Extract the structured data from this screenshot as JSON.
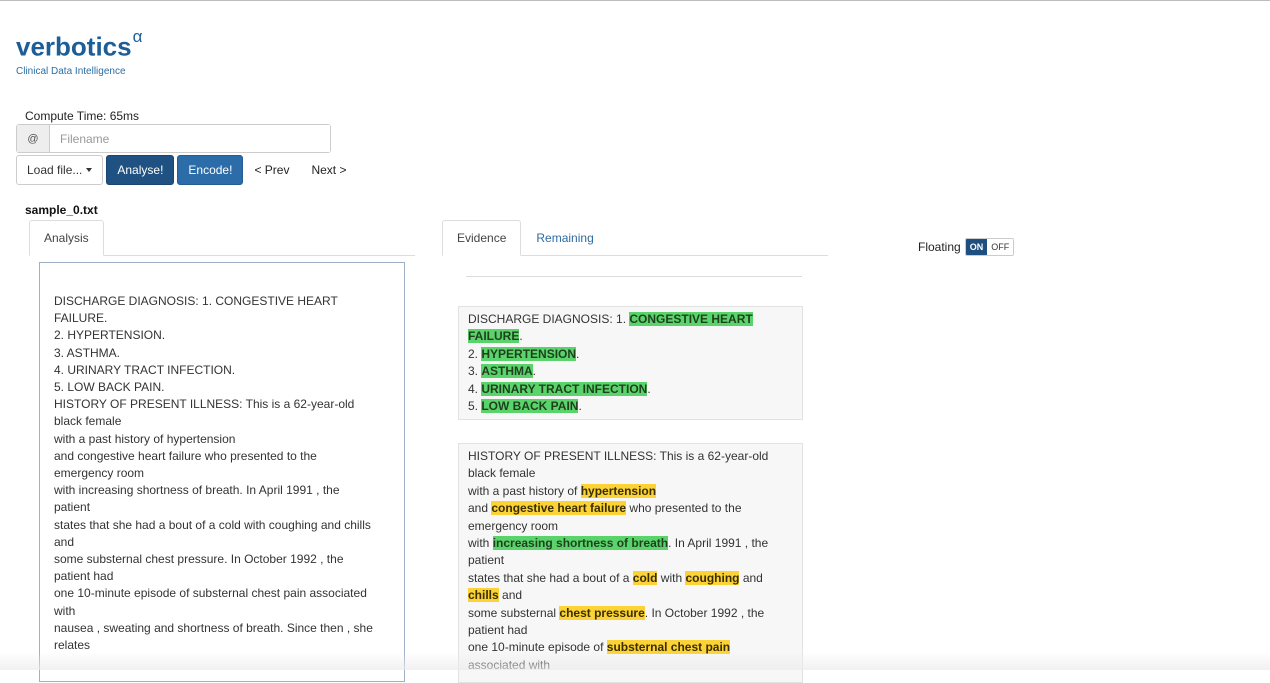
{
  "brand": {
    "name": "verbotics",
    "superscript": "α",
    "tagline": "Clinical Data Intelligence"
  },
  "compute_time": "Compute Time: 65ms",
  "filename_input": {
    "addon": "@",
    "placeholder": "Filename",
    "value": ""
  },
  "toolbar": {
    "load_label": "Load file...",
    "analyse_label": "Analyse!",
    "encode_label": "Encode!",
    "prev_label": "< Prev",
    "next_label": "Next >"
  },
  "current_file": "sample_0.txt",
  "analysis_tabs": [
    "Analysis"
  ],
  "evidence_tabs": [
    "Evidence",
    "Remaining"
  ],
  "floating": {
    "label": "Floating",
    "on": "ON",
    "off": "OFF",
    "state": "ON"
  },
  "analysis_lines": [
    "DISCHARGE DIAGNOSIS: 1. CONGESTIVE HEART",
    "FAILURE.",
    "2. HYPERTENSION.",
    "3. ASTHMA.",
    "4. URINARY TRACT INFECTION.",
    "5. LOW BACK PAIN.",
    "HISTORY OF PRESENT ILLNESS: This is a 62-year-old",
    "black female",
    "with a past history of hypertension",
    "and congestive heart failure who presented to the",
    "emergency room",
    "with increasing shortness of breath. In April 1991 , the",
    "patient",
    "states that she had a bout of a cold with coughing and chills",
    "and",
    "some substernal chest pressure. In October 1992 , the",
    "patient had",
    "one 10-minute episode of substernal chest pain associated",
    "with",
    "nausea , sweating and shortness of breath. Since then , she",
    "relates"
  ],
  "evidence_blocks": [
    [
      [
        {
          "t": "DISCHARGE DIAGNOSIS: 1. "
        },
        {
          "t": "CONGESTIVE HEART",
          "h": "g"
        }
      ],
      [
        {
          "t": "FAILURE",
          "h": "g"
        },
        {
          "t": "."
        }
      ],
      [
        {
          "t": "2. "
        },
        {
          "t": "HYPERTENSION",
          "h": "g"
        },
        {
          "t": "."
        }
      ],
      [
        {
          "t": "3. "
        },
        {
          "t": "ASTHMA",
          "h": "g"
        },
        {
          "t": "."
        }
      ],
      [
        {
          "t": "4. "
        },
        {
          "t": "URINARY TRACT INFECTION",
          "h": "g"
        },
        {
          "t": "."
        }
      ],
      [
        {
          "t": "5. "
        },
        {
          "t": "LOW BACK PAIN",
          "h": "g"
        },
        {
          "t": "."
        }
      ]
    ],
    [
      [
        {
          "t": "HISTORY OF PRESENT ILLNESS: This is a 62-year-old"
        }
      ],
      [
        {
          "t": "black female"
        }
      ],
      [
        {
          "t": "with a past history of "
        },
        {
          "t": "hypertension",
          "h": "y"
        }
      ],
      [
        {
          "t": "and "
        },
        {
          "t": "congestive heart failure",
          "h": "y"
        },
        {
          "t": " who presented to the"
        }
      ],
      [
        {
          "t": "emergency room"
        }
      ],
      [
        {
          "t": "with "
        },
        {
          "t": "increasing shortness of breath",
          "h": "g"
        },
        {
          "t": ". In April 1991 , the"
        }
      ],
      [
        {
          "t": "patient"
        }
      ],
      [
        {
          "t": "states that she had a bout of a "
        },
        {
          "t": "cold",
          "h": "y"
        },
        {
          "t": " with "
        },
        {
          "t": "coughing",
          "h": "y"
        },
        {
          "t": " and"
        }
      ],
      [
        {
          "t": "chills",
          "h": "y"
        },
        {
          "t": " and"
        }
      ],
      [
        {
          "t": "some substernal "
        },
        {
          "t": "chest pressure",
          "h": "y"
        },
        {
          "t": ". In October 1992 , the"
        }
      ],
      [
        {
          "t": "patient had"
        }
      ],
      [
        {
          "t": "one 10-minute episode of "
        },
        {
          "t": "substernal chest pain",
          "h": "y"
        }
      ],
      [
        {
          "t": "associated with"
        }
      ]
    ]
  ],
  "colors": {
    "brand": "#1e5e97",
    "primary": "#2c6ca9",
    "highlight_green": "#5ad46a",
    "highlight_yellow": "#fbd336",
    "link": "#2d6ca2"
  }
}
